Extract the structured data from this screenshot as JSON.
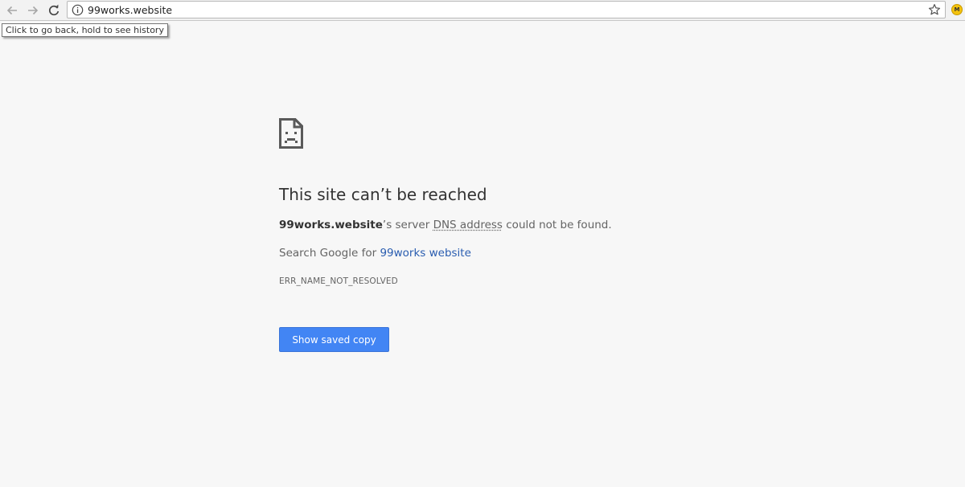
{
  "browser": {
    "url": "99works.website",
    "tooltip": "Click to go back, hold to see history",
    "extension_label": "M",
    "icons": {
      "back": "arrow-left-icon",
      "forward": "arrow-right-icon",
      "reload": "reload-icon",
      "info": "info-icon",
      "bookmark": "star-icon"
    }
  },
  "error_page": {
    "headline": "This site can’t be reached",
    "detail": {
      "host": "99works.website",
      "after_host": "’s server ",
      "dns": "DNS address",
      "tail": " could not be found."
    },
    "search": {
      "prefix": "Search Google for ",
      "link": "99works website"
    },
    "error_code": "ERR_NAME_NOT_RESOLVED",
    "button_label": "Show saved copy",
    "icon": "sad-page-icon"
  },
  "colors": {
    "page_background": "#f7f7f7",
    "button": "#4285f4",
    "link": "#2a5db0",
    "headline": "#333333",
    "text": "#646464"
  }
}
